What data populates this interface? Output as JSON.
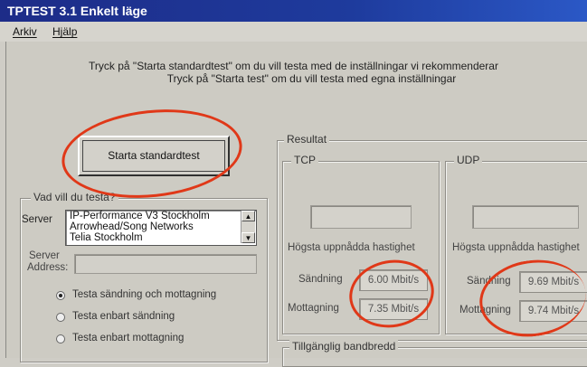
{
  "window": {
    "title": "TPTEST 3.1 Enkelt läge"
  },
  "menu": {
    "items": [
      "Arkiv",
      "Hjälp"
    ]
  },
  "instructions": [
    "Tryck på \"Starta standardtest\" om du vill testa med de inställningar vi rekommenderar",
    "Tryck på \"Starta test\" om du vill testa med egna inställningar"
  ],
  "start_button": {
    "label": "Starta standardtest"
  },
  "test_group": {
    "title": "Vad vill du testa?",
    "server_label": "Server",
    "server_list": [
      "IP-Performance V3 Stockholm",
      "Arrowhead/Song Networks",
      "Telia Stockholm"
    ],
    "address_label_1": "Server",
    "address_label_2": "Address:",
    "address_value": "",
    "options": [
      {
        "label": "Testa sändning och mottagning",
        "selected": true
      },
      {
        "label": "Testa enbart sändning",
        "selected": false
      },
      {
        "label": "Testa enbart mottagning",
        "selected": false
      }
    ]
  },
  "results": {
    "title": "Resultat",
    "tcp": {
      "title": "TCP",
      "heading": "Högsta uppnådda hastighet",
      "send_label": "Sändning",
      "send_value": "6.00 Mbit/s",
      "recv_label": "Mottagning",
      "recv_value": "7.35 Mbit/s"
    },
    "udp": {
      "title": "UDP",
      "heading": "Högsta uppnådda hastighet",
      "send_label": "Sändning",
      "send_value": "9.69 Mbit/s",
      "recv_label": "Mottagning",
      "recv_value": "9.74 Mbit/s"
    },
    "bandwidth_title": "Tillgänglig bandbredd"
  },
  "annotation_color": "#e03818"
}
